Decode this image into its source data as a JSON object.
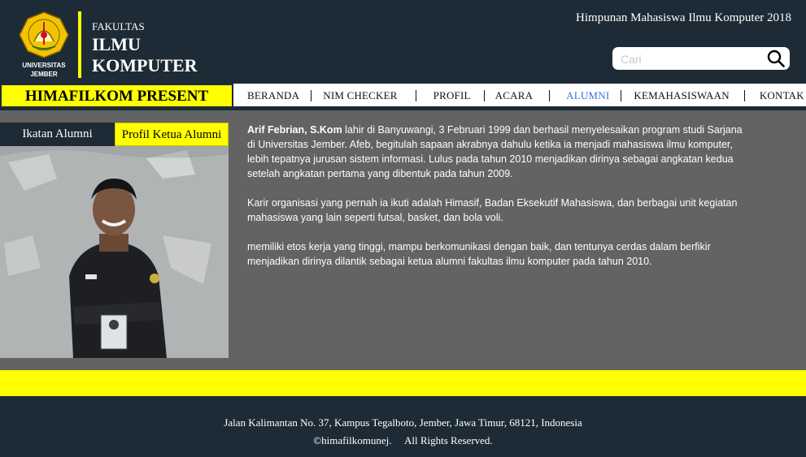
{
  "header": {
    "logo_line1": "UNIVERSITAS",
    "logo_line2": "JEMBER",
    "faculty_small": "FAKULTAS",
    "faculty_line1": "ILMU",
    "faculty_line2": "KOMPUTER",
    "org_title": "Himpunan Mahasiswa Ilmu Komputer 2018",
    "search_placeholder": "Cari"
  },
  "present_label": "HIMAFILKOM PRESENT",
  "nav": {
    "items": [
      {
        "label": "BERANDA"
      },
      {
        "label": "NIM CHECKER"
      },
      {
        "label": "PROFIL"
      },
      {
        "label": "ACARA"
      },
      {
        "label": "ALUMNI",
        "active": true
      },
      {
        "label": "KEMAHASISWAAN"
      },
      {
        "label": "KONTAK"
      }
    ],
    "active_color": "#3b74d6"
  },
  "side_tabs": {
    "ikatan": "Ikatan Alumni",
    "profil": "Profil Ketua Alumni"
  },
  "profile": {
    "name": "Arif Febrian, S.Kom",
    "para1_rest": " lahir di Banyuwangi, 3 Februari 1999 dan berhasil menyelesaikan program studi Sarjana di Universitas Jember. Afeb, begitulah sapaan akrabnya dahulu ketika ia menjadi mahasiswa ilmu komputer, lebih tepatnya jurusan sistem informasi. Lulus pada tahun 2010 menjadikan dirinya sebagai angkatan kedua setelah angkatan pertama yang dibentuk pada tahun 2009.",
    "para2": "Karir organisasi yang pernah ia ikuti adalah Himasif, Badan Eksekutif Mahasiswa, dan berbagai unit kegiatan mahasiswa yang lain seperti futsal, basket, dan bola voli.",
    "para3": "memiliki etos kerja yang tinggi, mampu berkomunikasi dengan baik, dan tentunya cerdas dalam berfikir menjadikan dirinya dilantik sebagai ketua alumni fakultas ilmu komputer pada tahun 2010."
  },
  "footer": {
    "address": "Jalan Kalimantan No. 37, Kampus Tegalboto, Jember, Jawa Timur, 68121, Indonesia",
    "copyright": "©himafilkomunej.     All Rights Reserved."
  },
  "colors": {
    "navy": "#1c2b36",
    "yellow": "#ffff00",
    "content_bg": "#636363"
  },
  "icons": [
    "university-logo-icon",
    "search-icon"
  ]
}
